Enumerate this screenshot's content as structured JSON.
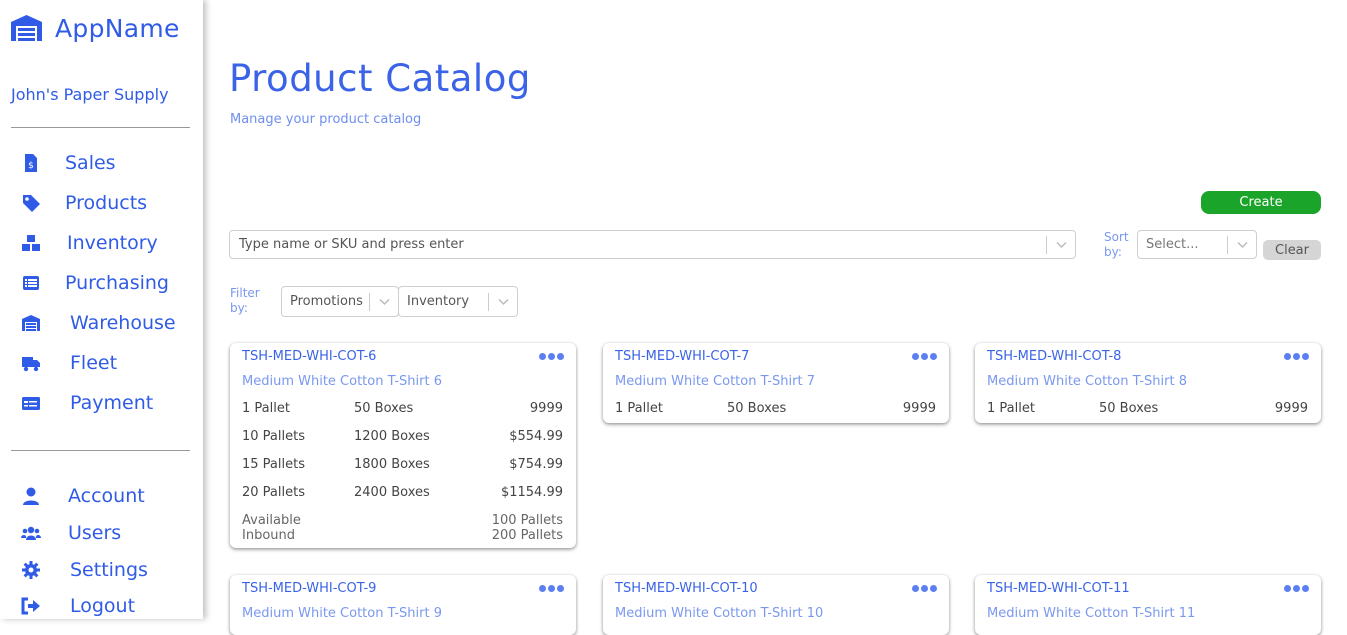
{
  "app": {
    "name": "AppName",
    "company": "John's Paper Supply"
  },
  "nav": [
    {
      "label": "Sales",
      "icon": "invoice-dollar-icon"
    },
    {
      "label": "Products",
      "icon": "tag-icon"
    },
    {
      "label": "Inventory",
      "icon": "boxes-icon"
    },
    {
      "label": "Purchasing",
      "icon": "list-icon"
    },
    {
      "label": "Warehouse",
      "icon": "warehouse-icon"
    },
    {
      "label": "Fleet",
      "icon": "truck-icon"
    },
    {
      "label": "Payment",
      "icon": "credit-card-icon"
    }
  ],
  "nav_secondary": [
    {
      "label": "Account",
      "icon": "user-icon"
    },
    {
      "label": "Users",
      "icon": "users-icon"
    },
    {
      "label": "Settings",
      "icon": "gear-icon"
    },
    {
      "label": "Logout",
      "icon": "sign-out-icon"
    }
  ],
  "page": {
    "title": "Product Catalog",
    "subtitle": "Manage your product catalog"
  },
  "toolbar": {
    "create_label": "Create",
    "search_placeholder": "Type name or SKU and press enter",
    "sort_label": "Sort by:",
    "sort_placeholder": "Select...",
    "clear_label": "Clear",
    "filter_label": "Filter by:",
    "filters": [
      "Promotions",
      "Inventory"
    ]
  },
  "products": [
    {
      "sku": "TSH-MED-WHI-COT-6",
      "name": "Medium White Cotton T-Shirt 6",
      "tiers": [
        {
          "qty": "1 Pallet",
          "boxes": "50 Boxes",
          "price": "9999"
        },
        {
          "qty": "10 Pallets",
          "boxes": "1200 Boxes",
          "price": "$554.99"
        },
        {
          "qty": "15 Pallets",
          "boxes": "1800 Boxes",
          "price": "$754.99"
        },
        {
          "qty": "20 Pallets",
          "boxes": "2400 Boxes",
          "price": "$1154.99"
        }
      ],
      "available_label": "Available",
      "available_value": "100 Pallets",
      "inbound_label": "Inbound",
      "inbound_value": "200 Pallets"
    },
    {
      "sku": "TSH-MED-WHI-COT-7",
      "name": "Medium White Cotton T-Shirt 7",
      "tiers": [
        {
          "qty": "1 Pallet",
          "boxes": "50 Boxes",
          "price": "9999"
        }
      ]
    },
    {
      "sku": "TSH-MED-WHI-COT-8",
      "name": "Medium White Cotton T-Shirt 8",
      "tiers": [
        {
          "qty": "1 Pallet",
          "boxes": "50 Boxes",
          "price": "9999"
        }
      ]
    },
    {
      "sku": "TSH-MED-WHI-COT-9",
      "name": "Medium White Cotton T-Shirt 9"
    },
    {
      "sku": "TSH-MED-WHI-COT-10",
      "name": "Medium White Cotton T-Shirt 10"
    },
    {
      "sku": "TSH-MED-WHI-COT-11",
      "name": "Medium White Cotton T-Shirt 11"
    }
  ],
  "colors": {
    "accent": "#2f5be7",
    "accent_light": "#7a98ef",
    "create": "#1aa52a",
    "clear": "#d5d5d5"
  }
}
